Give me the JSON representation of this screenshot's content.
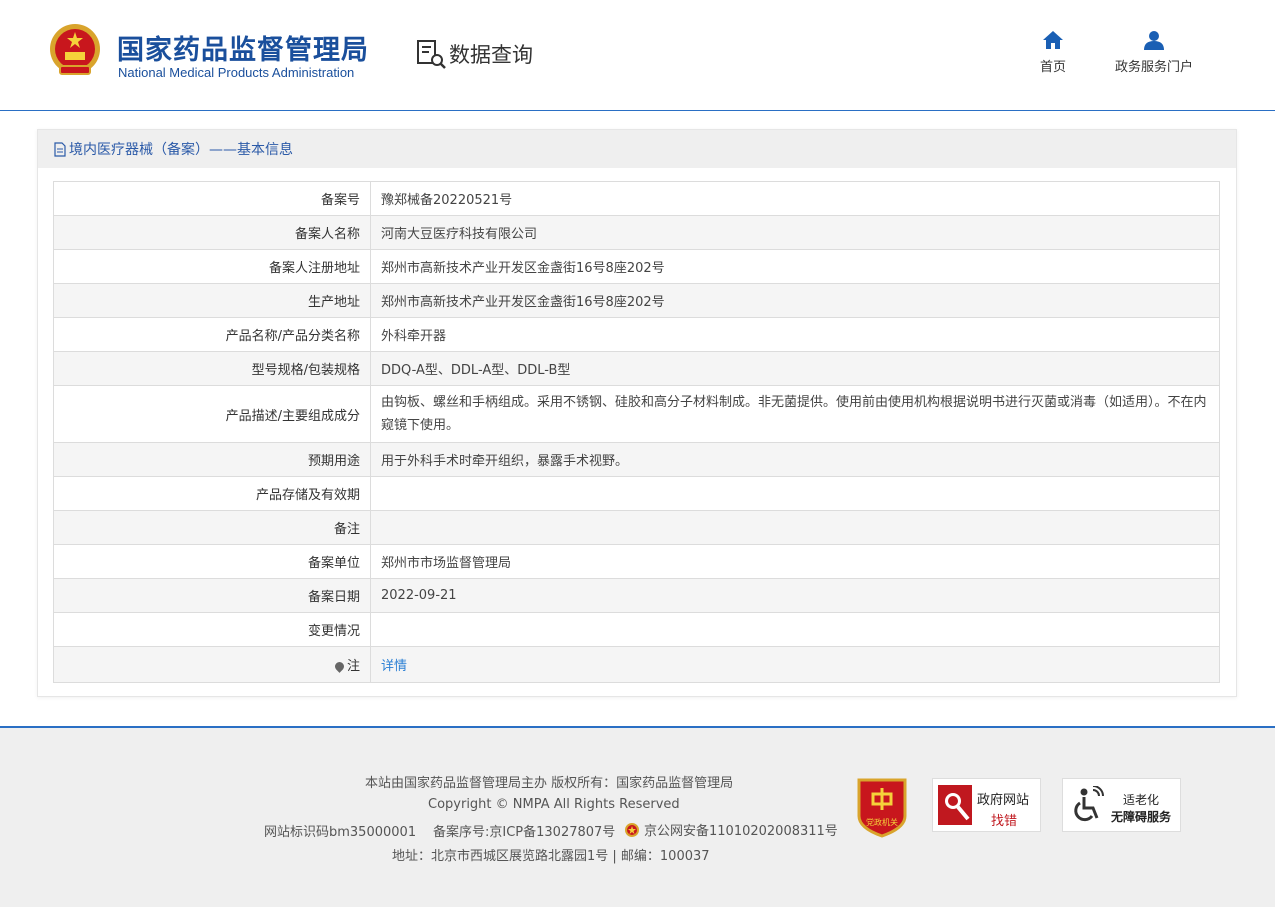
{
  "header": {
    "org_name_cn": "国家药品监督管理局",
    "org_name_en": "National Medical Products Administration",
    "section_title": "数据查询",
    "nav": [
      {
        "label": "首页",
        "icon": "home-icon"
      },
      {
        "label": "政务服务门户",
        "icon": "user-icon"
      }
    ]
  },
  "panel": {
    "title": "境内医疗器械（备案）——基本信息",
    "rows": [
      {
        "label": "备案号",
        "value": "豫郑械备20220521号"
      },
      {
        "label": "备案人名称",
        "value": "河南大豆医疗科技有限公司"
      },
      {
        "label": "备案人注册地址",
        "value": "郑州市高新技术产业开发区金盏街16号8座202号"
      },
      {
        "label": "生产地址",
        "value": "郑州市高新技术产业开发区金盏街16号8座202号"
      },
      {
        "label": "产品名称/产品分类名称",
        "value": "外科牵开器"
      },
      {
        "label": "型号规格/包装规格",
        "value": "DDQ-A型、DDL-A型、DDL-B型"
      },
      {
        "label": "产品描述/主要组成成分",
        "value": "由钩板、螺丝和手柄组成。采用不锈钢、硅胶和高分子材料制成。非无菌提供。使用前由使用机构根据说明书进行灭菌或消毒（如适用）。不在内窥镜下使用。"
      },
      {
        "label": "预期用途",
        "value": "用于外科手术时牵开组织，暴露手术视野。"
      },
      {
        "label": "产品存储及有效期",
        "value": ""
      },
      {
        "label": "备注",
        "value": ""
      },
      {
        "label": "备案单位",
        "value": "郑州市市场监督管理局"
      },
      {
        "label": "备案日期",
        "value": "2022-09-21"
      },
      {
        "label": "变更情况",
        "value": ""
      }
    ],
    "note": {
      "label": "注",
      "link": "详情"
    }
  },
  "footer": {
    "sponsor": "本站由国家药品监督管理局主办 版权所有：国家药品监督管理局",
    "copyright": "Copyright © NMPA All Rights Reserved",
    "site_code": "网站标识码bm35000001",
    "icp": "备案序号:京ICP备13027807号",
    "police": "京公网安备11010202008311号",
    "address": "地址：北京市西城区展览路北露园1号 | 邮编：100037",
    "badge_party": "党政机关",
    "badge_gov_line1": "政府网站",
    "badge_gov_line2": "找错",
    "badge_age_line1": "适老化",
    "badge_age_line2": "无障碍服务"
  },
  "colors": {
    "brand_blue": "#1a4f9c",
    "accent_line": "#2a6fc4",
    "link": "#2a7fd4",
    "badge_red": "#c0181f"
  }
}
